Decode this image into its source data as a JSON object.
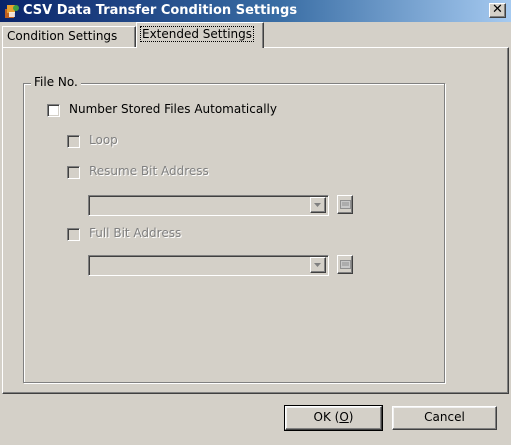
{
  "window": {
    "title": "CSV Data Transfer Condition Settings",
    "close_label": "✕"
  },
  "tabs": [
    {
      "label": "Condition Settings",
      "selected": false
    },
    {
      "label": "Extended Settings",
      "selected": true
    }
  ],
  "file_no": {
    "group_label": "File No.",
    "auto_number": {
      "label": "Number Stored Files Automatically",
      "checked": false,
      "enabled": true
    },
    "loop": {
      "label": "Loop",
      "checked": false,
      "enabled": false
    },
    "resume_bit": {
      "label": "Resume Bit Address",
      "checked": false,
      "enabled": false,
      "value": ""
    },
    "full_bit": {
      "label": "Full Bit Address",
      "checked": false,
      "enabled": false,
      "value": ""
    }
  },
  "buttons": {
    "ok_prefix": "OK (",
    "ok_mnemonic": "O",
    "ok_suffix": ")",
    "cancel": "Cancel"
  },
  "colors": {
    "title_start": "#0a246a",
    "title_end": "#a6caf0",
    "face": "#d4d0c8"
  },
  "icons": [
    "app-icon",
    "close-icon",
    "dropdown-arrow-icon",
    "address-picker-icon"
  ]
}
